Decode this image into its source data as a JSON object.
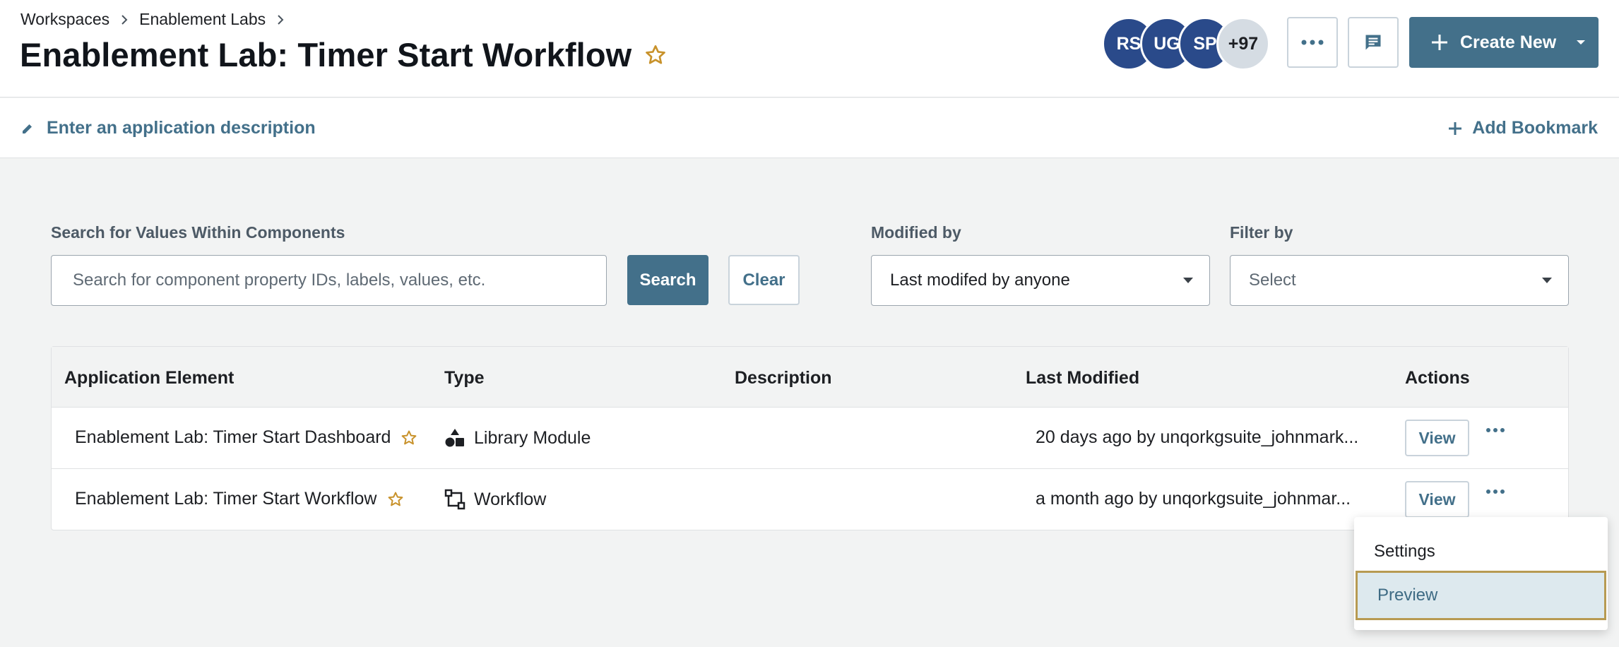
{
  "breadcrumb": {
    "items": [
      "Workspaces",
      "Enablement Labs"
    ]
  },
  "header": {
    "title": "Enablement Lab: Timer Start Workflow",
    "avatars": [
      "RS",
      "UG",
      "SP"
    ],
    "avatar_more": "+97",
    "create_label": "Create New"
  },
  "description_bar": {
    "placeholder": "Enter an application description",
    "add_bookmark": "Add Bookmark"
  },
  "filters": {
    "search_label": "Search for Values Within Components",
    "search_placeholder": "Search for component property IDs, labels, values, etc.",
    "search_button": "Search",
    "clear_button": "Clear",
    "modified_label": "Modified by",
    "modified_value": "Last modifed by anyone",
    "filter_label": "Filter by",
    "filter_value": "Select"
  },
  "table": {
    "columns": [
      "Application Element",
      "Type",
      "Description",
      "Last Modified",
      "Actions"
    ],
    "rows": [
      {
        "name": "Enablement Lab: Timer Start Dashboard",
        "type": "Library Module",
        "type_icon": "library-module-icon",
        "description": "",
        "modified": "20 days ago by unqorkgsuite_johnmark...",
        "view": "View"
      },
      {
        "name": "Enablement Lab: Timer Start Workflow",
        "type": "Workflow",
        "type_icon": "workflow-icon",
        "description": "",
        "modified": "a month ago by unqorkgsuite_johnmar...",
        "view": "View"
      }
    ]
  },
  "menu": {
    "items": [
      "Settings",
      "Preview"
    ],
    "highlighted": "Preview"
  },
  "colors": {
    "accent": "#43708a",
    "star": "#c8922b",
    "avatar": "#2a4a8a",
    "highlight_border": "#b79a52"
  }
}
